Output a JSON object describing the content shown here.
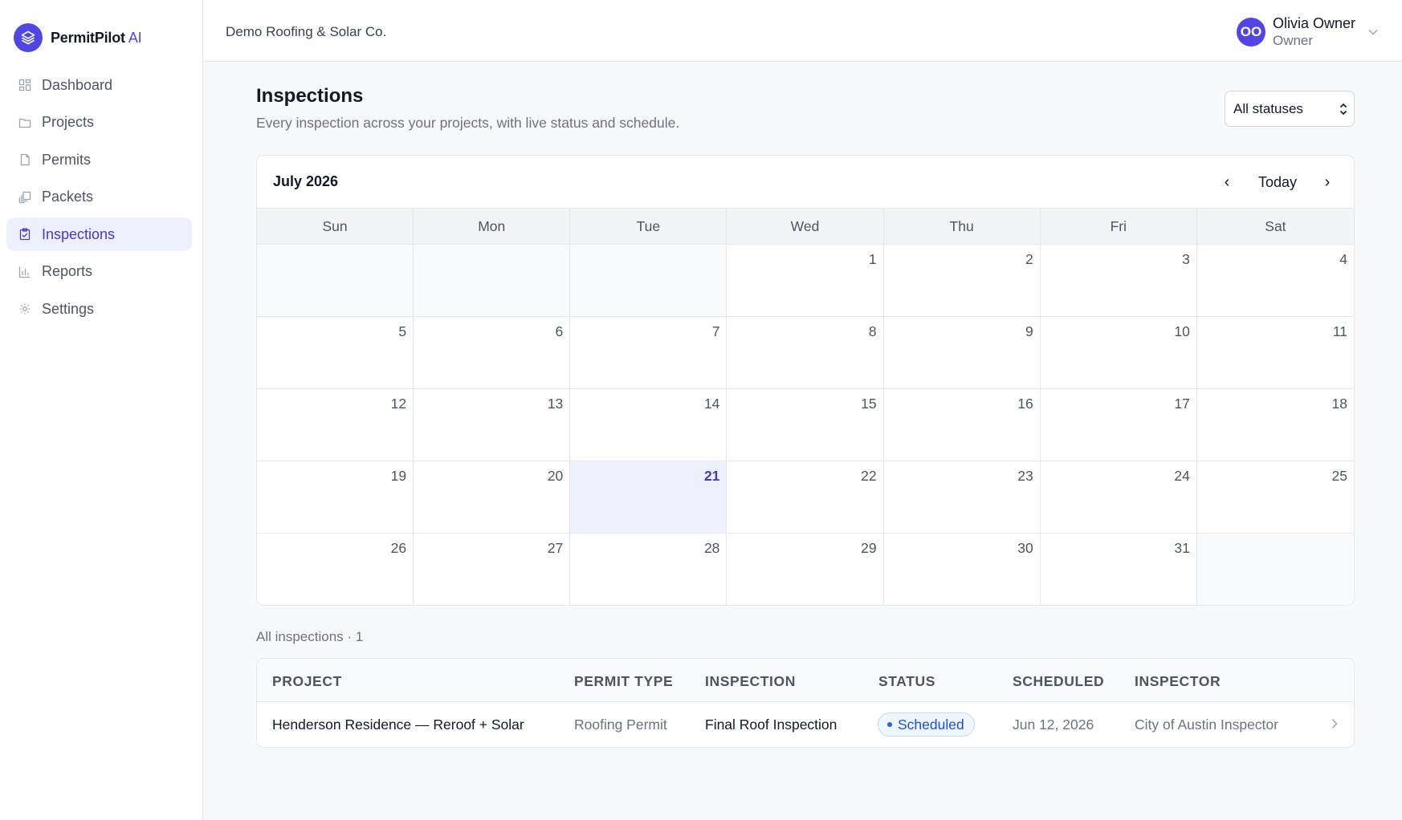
{
  "brand": {
    "name": "PermitPilot",
    "ai": "AI"
  },
  "sidebar": {
    "items": [
      {
        "label": "Dashboard",
        "icon": "dashboard-icon",
        "active": false
      },
      {
        "label": "Projects",
        "icon": "folder-icon",
        "active": false
      },
      {
        "label": "Permits",
        "icon": "document-icon",
        "active": false
      },
      {
        "label": "Packets",
        "icon": "packets-icon",
        "active": false
      },
      {
        "label": "Inspections",
        "icon": "clipboard-check-icon",
        "active": true
      },
      {
        "label": "Reports",
        "icon": "bar-chart-icon",
        "active": false
      },
      {
        "label": "Settings",
        "icon": "gear-icon",
        "active": false
      }
    ]
  },
  "topbar": {
    "org": "Demo Roofing & Solar Co.",
    "user": {
      "initials": "OO",
      "name": "Olivia Owner",
      "role": "Owner"
    }
  },
  "page": {
    "title": "Inspections",
    "subtitle": "Every inspection across your projects, with live status and schedule.",
    "filter": {
      "selected": "All statuses"
    }
  },
  "calendar": {
    "month": "July 2026",
    "prev": "‹",
    "today_label": "Today",
    "next": "›",
    "weekdays": [
      "Sun",
      "Mon",
      "Tue",
      "Wed",
      "Thu",
      "Fri",
      "Sat"
    ],
    "cells": [
      "",
      "",
      "",
      "1",
      "2",
      "3",
      "4",
      "5",
      "6",
      "7",
      "8",
      "9",
      "10",
      "11",
      "12",
      "13",
      "14",
      "15",
      "16",
      "17",
      "18",
      "19",
      "20",
      "21",
      "22",
      "23",
      "24",
      "25",
      "26",
      "27",
      "28",
      "29",
      "30",
      "31",
      ""
    ],
    "today": "21"
  },
  "list": {
    "label": "All inspections · 1",
    "columns": [
      "PROJECT",
      "PERMIT TYPE",
      "INSPECTION",
      "STATUS",
      "SCHEDULED",
      "INSPECTOR"
    ],
    "rows": [
      {
        "project": "Henderson Residence — Reroof + Solar",
        "permit_type": "Roofing Permit",
        "inspection": "Final Roof Inspection",
        "status": "Scheduled",
        "scheduled": "Jun 12, 2026",
        "inspector": "City of Austin Inspector"
      }
    ]
  },
  "colors": {
    "accent": "#4f46e5",
    "active_nav_bg": "#eef0fd",
    "status_scheduled": "#1d4ed8"
  }
}
